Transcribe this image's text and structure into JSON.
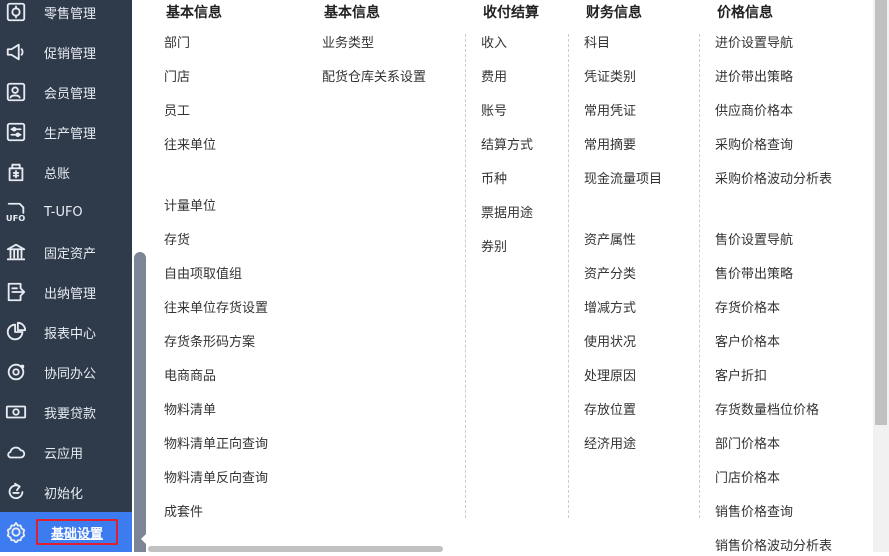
{
  "sidebar": {
    "items": [
      {
        "label": "零售管理",
        "icon": "retail-icon"
      },
      {
        "label": "促销管理",
        "icon": "megaphone-icon"
      },
      {
        "label": "会员管理",
        "icon": "member-card-icon"
      },
      {
        "label": "生产管理",
        "icon": "production-icon"
      },
      {
        "label": "总账",
        "icon": "ledger-icon"
      },
      {
        "label": "T-UFO",
        "icon": "ufo-report-icon"
      },
      {
        "label": "固定资产",
        "icon": "bank-icon"
      },
      {
        "label": "出纳管理",
        "icon": "cashier-icon"
      },
      {
        "label": "报表中心",
        "icon": "pie-chart-icon"
      },
      {
        "label": "协同办公",
        "icon": "collaboration-icon"
      },
      {
        "label": "我要贷款",
        "icon": "money-icon"
      },
      {
        "label": "云应用",
        "icon": "cloud-icon"
      },
      {
        "label": "初始化",
        "icon": "refresh-icon"
      },
      {
        "label": "基础设置",
        "icon": "settings-gear-icon",
        "active": true
      }
    ]
  },
  "menu": {
    "columns": [
      {
        "header": "基本信息",
        "groups": [
          [
            "部门",
            "门店",
            "员工",
            "往来单位"
          ],
          [
            "计量单位",
            "存货",
            "自由项取值组",
            "往来单位存货设置",
            "存货条形码方案",
            "电商商品",
            "物料清单",
            "物料清单正向查询",
            "物料清单反向查询",
            "成套件"
          ]
        ]
      },
      {
        "header": "基本信息",
        "groups": [
          [
            "业务类型",
            "配货仓库关系设置"
          ]
        ]
      },
      {
        "header": "收付结算",
        "groups": [
          [
            "收入",
            "费用",
            "账号",
            "结算方式",
            "币种",
            "票据用途",
            "券别"
          ]
        ]
      },
      {
        "header": "财务信息",
        "groups": [
          [
            "科目",
            "凭证类别",
            "常用凭证",
            "常用摘要",
            "现金流量项目"
          ],
          [
            "资产属性",
            "资产分类",
            "增减方式",
            "使用状况",
            "处理原因",
            "存放位置",
            "经济用途"
          ]
        ]
      },
      {
        "header": "价格信息",
        "groups": [
          [
            "进价设置导航",
            "进价带出策略",
            "供应商价格本",
            "采购价格查询",
            "采购价格波动分析表"
          ],
          [
            "售价设置导航",
            "售价带出策略",
            "存货价格本",
            "客户价格本",
            "客户折扣",
            "存货数量档位价格",
            "部门价格本",
            "门店价格本",
            "销售价格查询",
            "销售价格波动分析表"
          ]
        ]
      }
    ]
  },
  "colors": {
    "sidebar_bg": "#2f3a4b",
    "active_bg": "#3d7bf0",
    "highlight_border": "#e0202e"
  }
}
